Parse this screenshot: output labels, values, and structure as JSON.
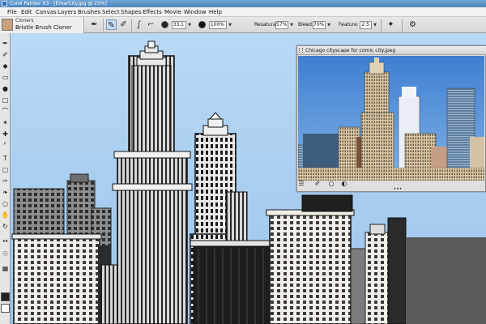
{
  "window": {
    "title": "Corel Painter X3 - [EmarCity.jpg @ 25%]"
  },
  "menu": {
    "items": [
      "File",
      "Edit",
      "Canvas",
      "Layers",
      "Brushes",
      "Select",
      "Shapes",
      "Effects",
      "Movie",
      "Window",
      "Help"
    ]
  },
  "property_bar": {
    "brush_category": "Cloners",
    "brush_variant": "Bristle Brush Cloner",
    "size_value": "33.1",
    "opacity_value": "100%",
    "resaturation_label": "Resaturation:",
    "resaturation_value": "57%",
    "bleed_label": "Bleed:",
    "bleed_value": "70%",
    "feature_label": "Feature:",
    "feature_value": "2.5"
  },
  "clone_source_panel": {
    "title": "Chicago cityscape for comic city.jpeg"
  },
  "colors": {
    "accent": "#4f86bd",
    "sky": "#a7cdf2",
    "photo_sky": "#5b93d8",
    "panel_bg": "#dedede"
  },
  "icons": {
    "toolbox": [
      "brush-icon",
      "eyedropper-icon",
      "paint-bucket-icon",
      "eraser-icon",
      "dodge-icon",
      "rectangle-select-icon",
      "lasso-icon",
      "magic-wand-icon",
      "transform-icon",
      "crop-icon",
      "text-icon",
      "shape-icon",
      "pen-icon",
      "cloner-icon",
      "magnifier-icon",
      "grabber-icon",
      "rotate-icon"
    ],
    "property_bar": [
      "cloner-brush-icon",
      "clone-source-icon",
      "tracing-icon",
      "stroke-type-icon",
      "size-icon",
      "opacity-icon",
      "extra-icon"
    ]
  }
}
